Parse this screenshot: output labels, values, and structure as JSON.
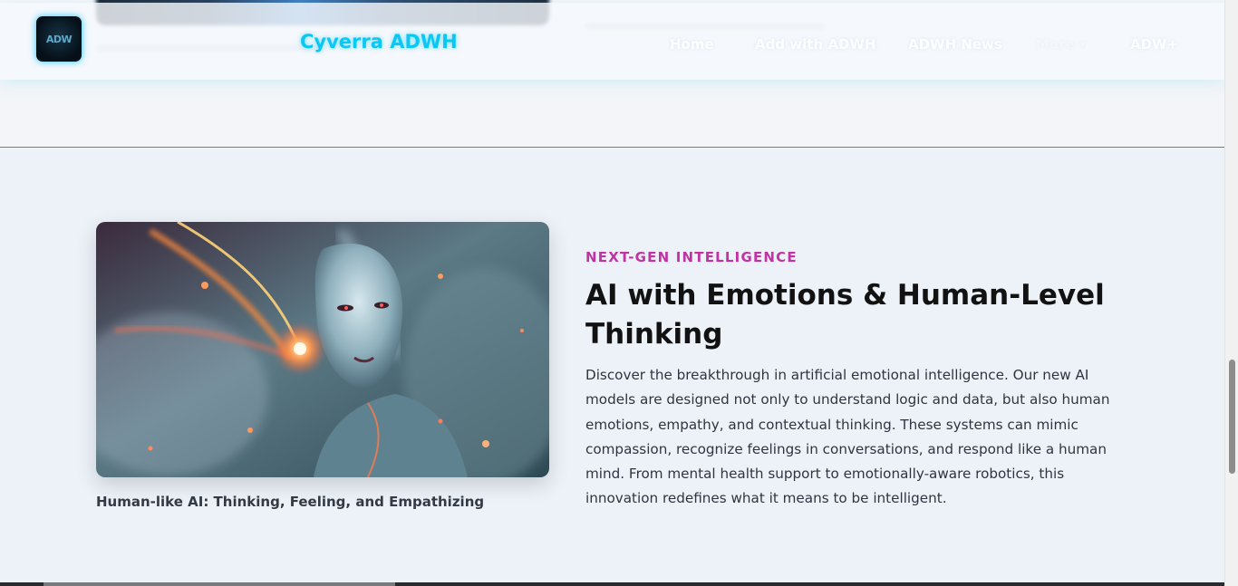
{
  "navbar": {
    "logo_text": "ADW",
    "brand": "Cyverra ADWH",
    "items": [
      {
        "label": "Home"
      },
      {
        "label": "Add with ADWH"
      },
      {
        "label": "ADWH News"
      },
      {
        "label": "More"
      },
      {
        "label": "ADW+"
      }
    ]
  },
  "feature": {
    "image_icon": "ai-woman-image",
    "caption": "Human-like AI: Thinking, Feeling, and Empathizing",
    "eyebrow": "NEXT-GEN INTELLIGENCE",
    "title": "AI with Emotions & Human-Level Thinking",
    "description": "Discover the breakthrough in artificial emotional intelligence. Our new AI models are designed not only to understand logic and data, but also human emotions, empathy, and contextual thinking. These systems can mimic compassion, recognize feelings in conversations, and respond like a human mind. From mental health support to emotionally-aware robotics, this innovation redefines what it means to be intelligent."
  },
  "colors": {
    "brand": "#0ac7f4",
    "eyebrow": "#c033a3",
    "heading": "#121212",
    "section_bg": "#edf2f8"
  }
}
